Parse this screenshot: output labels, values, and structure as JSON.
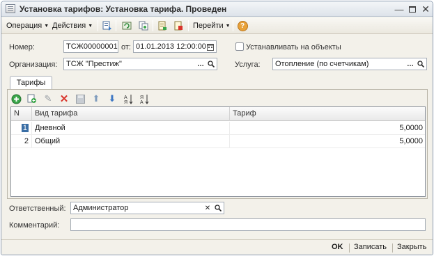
{
  "window": {
    "title": "Установка тарифов: Установка тарифа. Проведен",
    "controls": [
      "minimize-icon",
      "maximize-icon",
      "close-icon"
    ]
  },
  "toolbar": {
    "operation_label": "Операция",
    "actions_label": "Действия",
    "goto_label": "Перейти",
    "help_symbol": "?"
  },
  "form": {
    "number_label": "Номер:",
    "number_value": "ТСЖ00000001",
    "from_label": "от:",
    "date_value": "01.01.2013 12:00:00",
    "install_on_objects_label": "Устанавливать на объекты",
    "install_on_objects_checked": false,
    "organization_label": "Организация:",
    "organization_value": "ТСЖ \"Престиж\"",
    "service_label": "Услуга:",
    "service_value": "Отопление (по счетчикам)",
    "responsible_label": "Ответственный:",
    "responsible_value": "Администратор",
    "comment_label": "Комментарий:",
    "comment_value": ""
  },
  "tabs": [
    {
      "label": "Тарифы",
      "active": true
    }
  ],
  "table": {
    "columns": [
      "N",
      "Вид тарифа",
      "Тариф"
    ],
    "rows": [
      {
        "n": "1",
        "kind": "Дневной",
        "rate": "5,0000"
      },
      {
        "n": "2",
        "kind": "Общий",
        "rate": "5,0000"
      }
    ]
  },
  "footer": {
    "ok_label": "OK",
    "save_label": "Записать",
    "close_label": "Закрыть"
  },
  "colors": {
    "selection": "#3a6ea5",
    "delete_icon": "#d9342b",
    "add_icon": "#3aa64a",
    "help_icon": "#e8a23a"
  }
}
